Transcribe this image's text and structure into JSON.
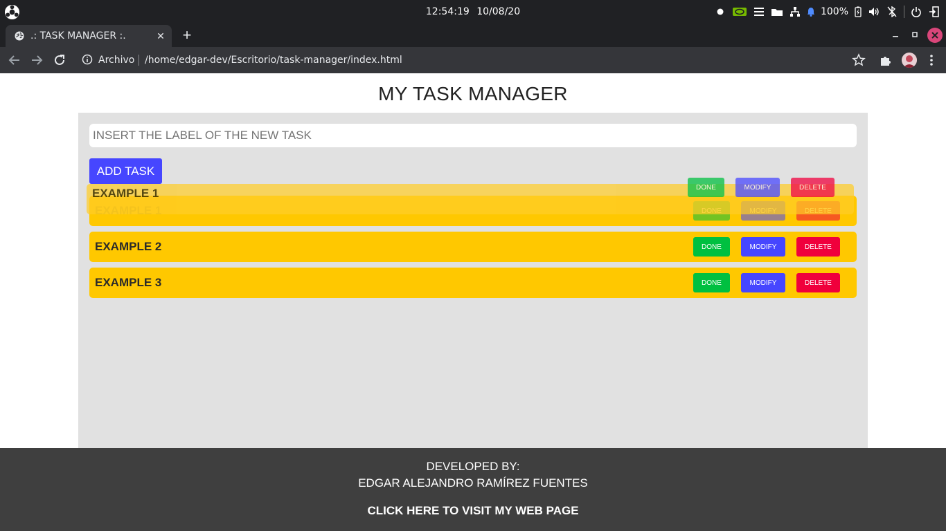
{
  "os": {
    "time": "12:54:19",
    "date": "10/08/20",
    "battery": "100%",
    "icons": [
      "distro-logo-icon",
      "dot-icon",
      "nvidia-icon",
      "menu-icon",
      "folder-icon",
      "network-icon",
      "notification-bell-icon",
      "battery-icon",
      "volume-icon",
      "bluetooth-icon",
      "power-icon",
      "logout-icon"
    ]
  },
  "browser": {
    "tab_title": ".: TASK MANAGER :.",
    "tab_close": "✕",
    "new_tab": "+",
    "url_scheme": "Archivo",
    "url": "/home/edgar-dev/Escritorio/task-manager/index.html",
    "icons": [
      "back-icon",
      "forward-icon",
      "reload-icon",
      "info-icon",
      "star-icon",
      "extensions-icon",
      "profile-avatar",
      "kebab-menu-icon"
    ]
  },
  "app": {
    "title": "MY TASK MANAGER",
    "input_placeholder": "INSERT THE LABEL OF THE NEW TASK",
    "add_button": "ADD TASK",
    "button_labels": {
      "done": "DONE",
      "modify": "MODIFY",
      "delete": "DELETE"
    },
    "dragging_task": "EXAMPLE 1",
    "tasks": [
      {
        "label": "EXAMPLE 1",
        "state": "drag-source"
      },
      {
        "label": "EXAMPLE 2",
        "state": "normal"
      },
      {
        "label": "EXAMPLE 3",
        "state": "normal"
      }
    ]
  },
  "footer": {
    "line1": "DEVELOPED BY:",
    "line2": "EDGAR ALEJANDRO RAMÍREZ FUENTES",
    "link": "CLICK HERE TO VISIT MY WEB PAGE"
  },
  "colors": {
    "panel": "#e1e1e1",
    "task": "#ffc800",
    "done": "#00c040",
    "modify": "#4646ff",
    "delete": "#f0003c",
    "footer": "#3f3f3f"
  }
}
